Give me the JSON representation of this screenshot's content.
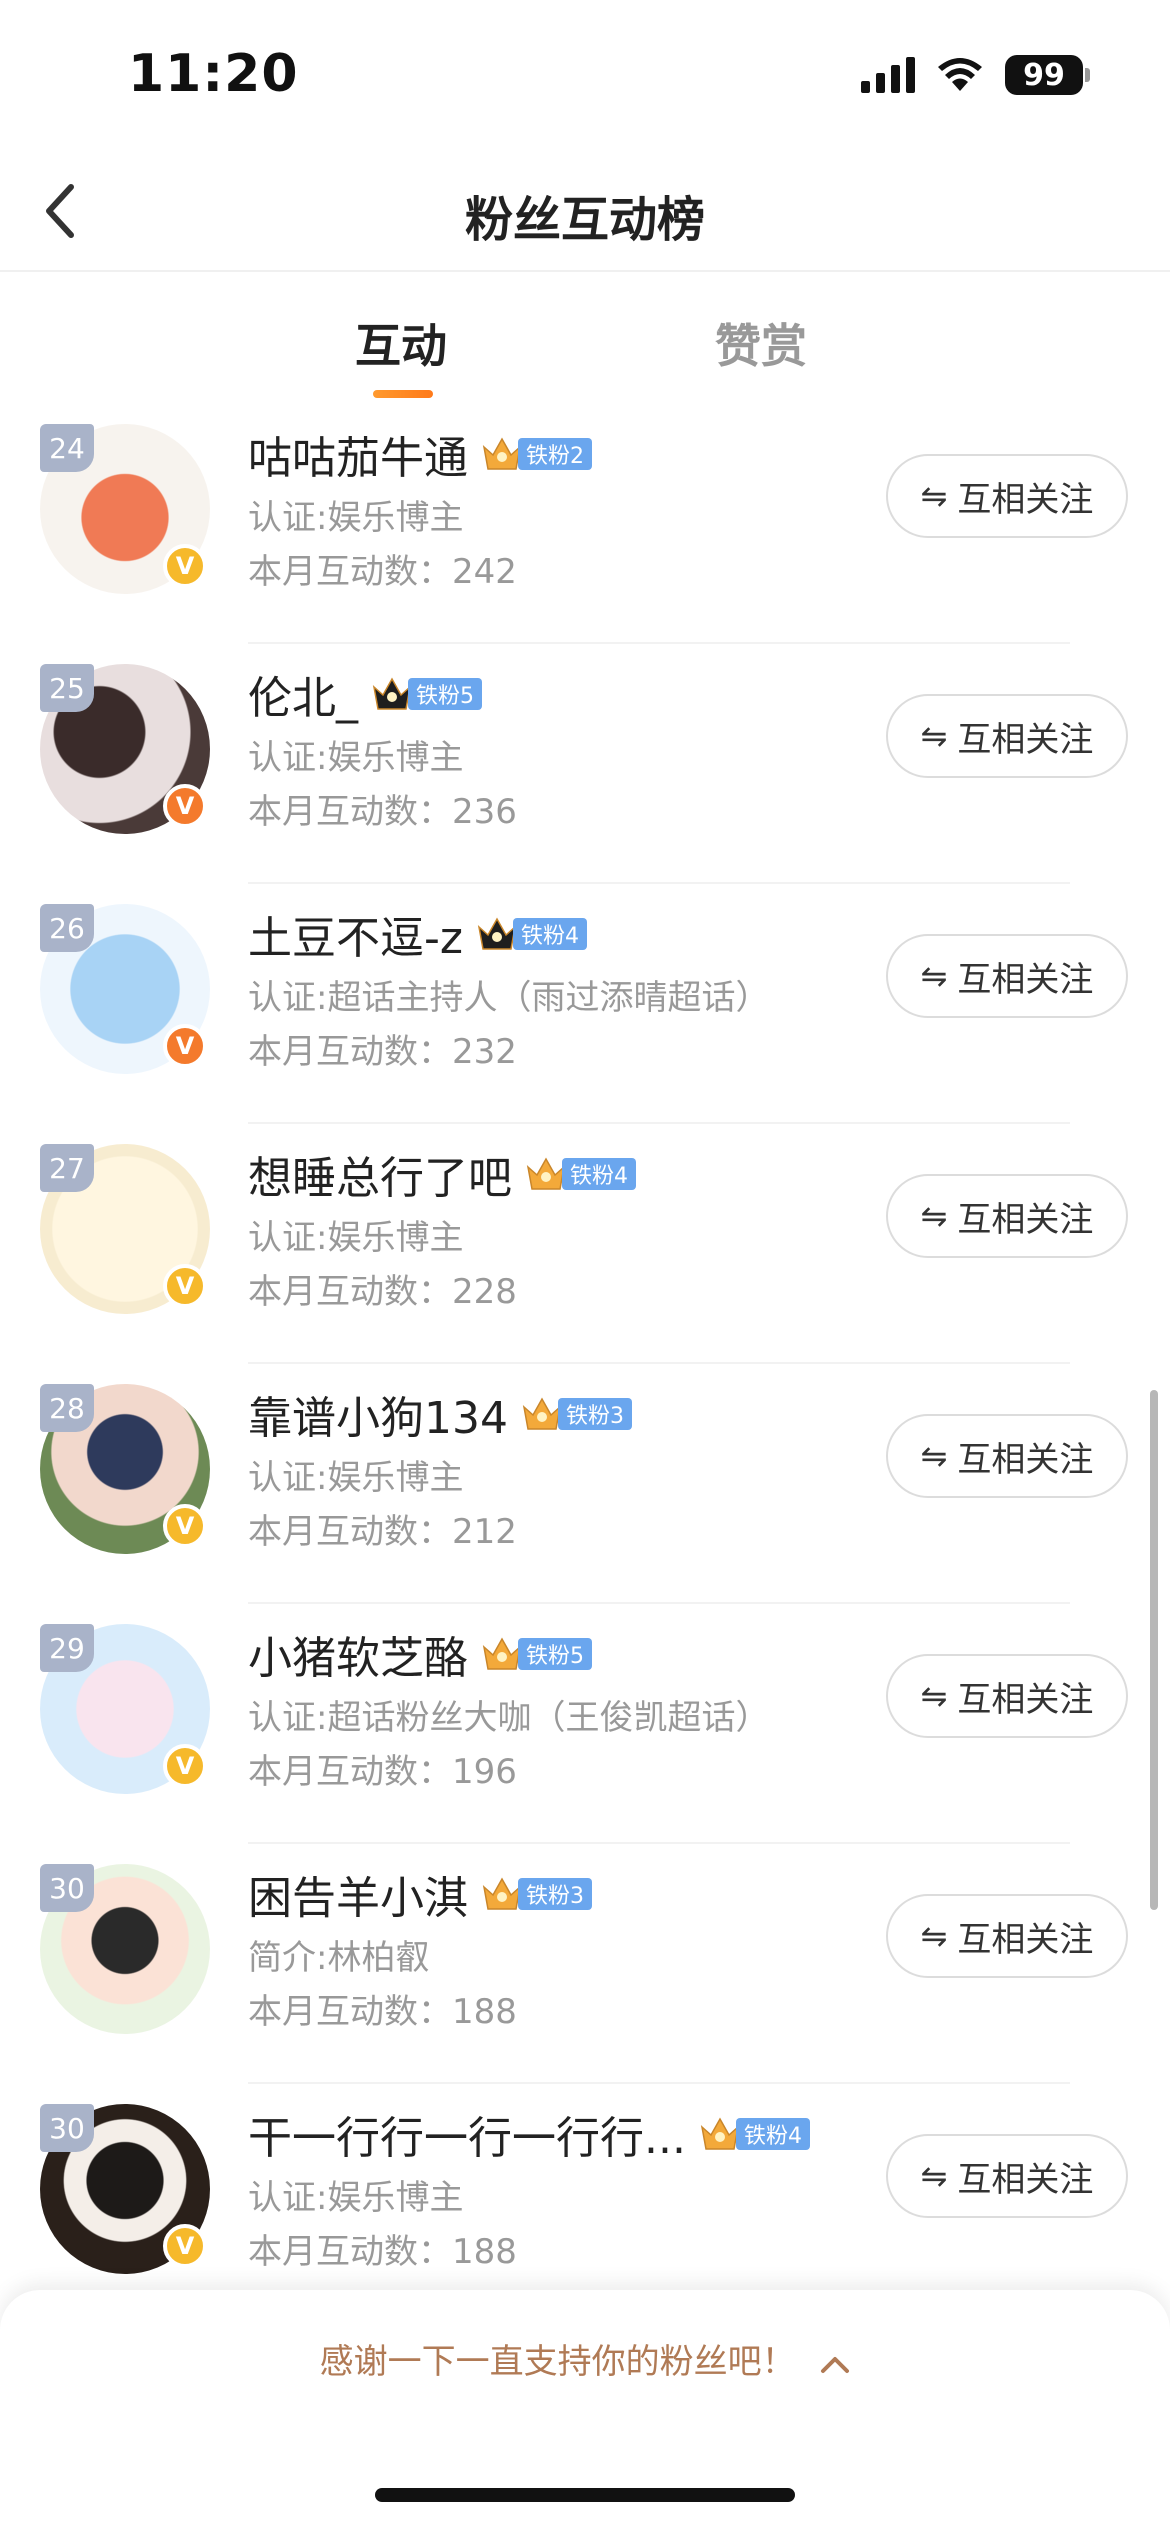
{
  "status_bar": {
    "time": "11:20",
    "battery": "99"
  },
  "nav": {
    "title": "粉丝互动榜"
  },
  "tabs": [
    {
      "label": "互动",
      "active": true
    },
    {
      "label": "赞赏",
      "active": false
    }
  ],
  "follow_label": "互相关注",
  "rows": [
    {
      "rank": "24",
      "name": "咕咕茄牛通",
      "fan_level": "铁粉2",
      "sub": "认证:娱乐博主",
      "count": "本月互动数：242",
      "v_color": "gold"
    },
    {
      "rank": "25",
      "name": "伦北_",
      "fan_level": "铁粉5",
      "sub": "认证:娱乐博主",
      "count": "本月互动数：236",
      "v_color": "orange"
    },
    {
      "rank": "26",
      "name": "土豆不逗-z",
      "fan_level": "铁粉4",
      "sub": "认证:超话主持人（雨过添晴超话）",
      "count": "本月互动数：232",
      "v_color": "orange"
    },
    {
      "rank": "27",
      "name": "想睡总行了吧",
      "fan_level": "铁粉4",
      "sub": "认证:娱乐博主",
      "count": "本月互动数：228",
      "v_color": "gold"
    },
    {
      "rank": "28",
      "name": "靠谱小狗134",
      "fan_level": "铁粉3",
      "sub": "认证:娱乐博主",
      "count": "本月互动数：212",
      "v_color": "gold"
    },
    {
      "rank": "29",
      "name": "小猪软芝酪",
      "fan_level": "铁粉5",
      "sub": "认证:超话粉丝大咖（王俊凯超话）",
      "count": "本月互动数：196",
      "v_color": "gold"
    },
    {
      "rank": "30",
      "name": "困告羊小淇",
      "fan_level": "铁粉3",
      "sub": "简介:林柏叡",
      "count": "本月互动数：188",
      "v_color": ""
    },
    {
      "rank": "30",
      "name": "干一行行一行一行行...",
      "fan_level": "铁粉4",
      "sub": "认证:娱乐博主",
      "count": "本月互动数：188",
      "v_color": "gold"
    }
  ],
  "bottom": {
    "thanks": "感谢一下一直支持你的粉丝吧！"
  },
  "colors": {
    "accent": "#ff8a1f",
    "fan_tag": "#6aa6ee",
    "rank_badge": "#a9b3c9",
    "v_gold": "#f6b92b",
    "v_orange": "#f47a2c"
  }
}
